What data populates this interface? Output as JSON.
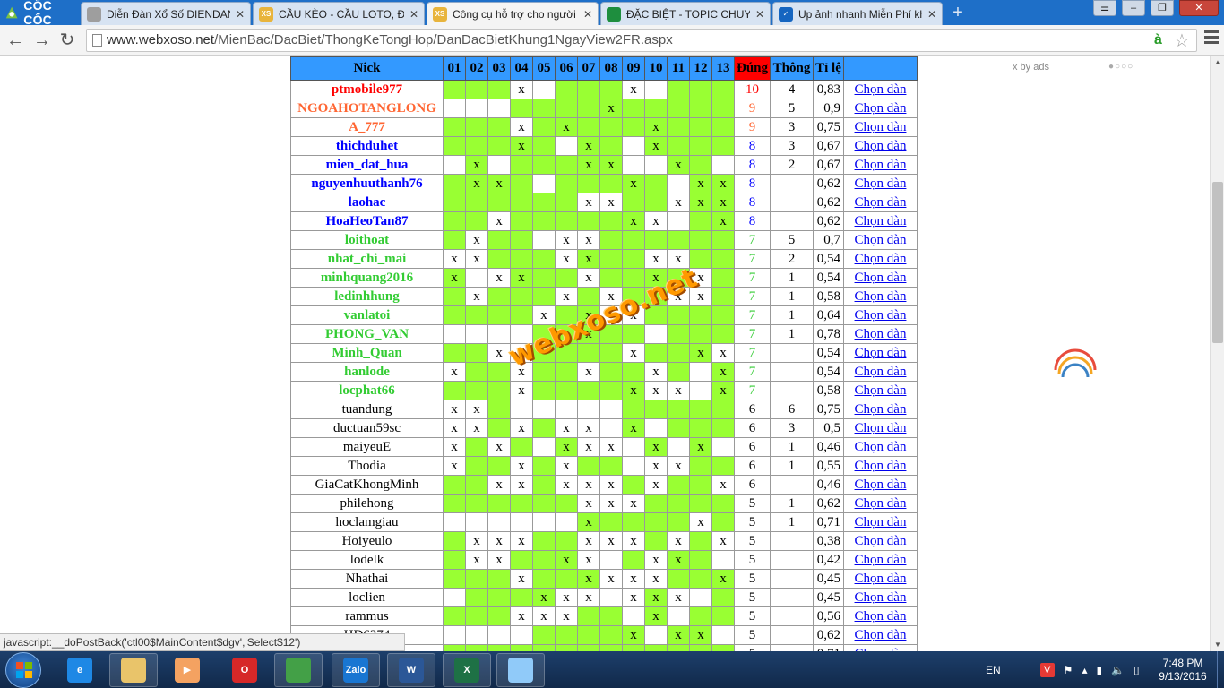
{
  "browser": {
    "brand": "CỐC CỐC",
    "tabs": [
      {
        "title": "Diễn Đàn Xổ Số DIENDAN",
        "icon": "page-icon",
        "active": false
      },
      {
        "title": "CẦU KÈO - CẦU LOTO, ĐÁ",
        "icon": "xs-icon",
        "active": false
      },
      {
        "title": "Công cụ hỗ trợ cho người",
        "icon": "xs-icon",
        "active": true
      },
      {
        "title": "ĐẶC BIỆT - TOPIC CHUYÊN",
        "icon": "sheet-icon",
        "active": false
      },
      {
        "title": "Up ảnh nhanh Miễn Phí kh",
        "icon": "check-icon",
        "active": false
      }
    ],
    "url_host": "www.webxoso.net",
    "url_path": "/MienBac/DacBiet/ThongKeTongHop/DanDacBietKhung1NgayView2FR.aspx",
    "status_text": "javascript:__doPostBack('ctl00$MainContent$dgv','Select$12')"
  },
  "table": {
    "headers": {
      "nick": "Nick",
      "cols": [
        "01",
        "02",
        "03",
        "04",
        "05",
        "06",
        "07",
        "08",
        "09",
        "10",
        "11",
        "12",
        "13"
      ],
      "dung": "Đúng",
      "thong": "Thông",
      "tile": "Tỉ lệ"
    },
    "link_label": "Chọn dàn",
    "rows": [
      {
        "nick": "ptmobile977",
        "color": "red",
        "cells": "ggg xggg xggg ",
        "x": "   x    x    ",
        "dung": "10",
        "thong": "4",
        "tile": "0,83"
      },
      {
        "nick": "NGOAHOTANGLONG",
        "color": "orange",
        "cells": "   ggggggggggg",
        "x": "       x     ",
        "dung": "9",
        "thong": "5",
        "tile": "0,9"
      },
      {
        "nick": "A_777",
        "color": "orange",
        "cells": "ggg gggggggggg",
        "x": "   x x   x   ",
        "dung": "9",
        "thong": "3",
        "tile": "0,75"
      },
      {
        "nick": "thichduhet",
        "color": "blue",
        "cells": "ggggg gg ggggg",
        "x": "   x  x  x   ",
        "dung": "8",
        "thong": "3",
        "tile": "0,67"
      },
      {
        "nick": "mien_dat_hua",
        "color": "blue",
        "cells": " g ggggg  gg gg",
        "x": " x    xx  x  ",
        "dung": "8",
        "thong": "2",
        "tile": "0,67"
      },
      {
        "nick": "nguyenhuuthanh76",
        "color": "blue",
        "cells": "gggg ggggg ggg",
        "x": " xx     x  xx",
        "dung": "8",
        "thong": "",
        "tile": "0,62"
      },
      {
        "nick": "laohac",
        "color": "blue",
        "cells": "gggggg  gg ggg",
        "x": "      xx  xxx",
        "dung": "8",
        "thong": "",
        "tile": "0,62"
      },
      {
        "nick": "HoaHeoTan87",
        "color": "blue",
        "cells": "gg gggggg  gg ",
        "x": "  x     xx  x",
        "dung": "8",
        "thong": "",
        "tile": "0,62"
      },
      {
        "nick": "loithoat",
        "color": "green",
        "cells": "g gg   ggggggg",
        "x": " x   xx      ",
        "dung": "7",
        "thong": "5",
        "tile": "0,7"
      },
      {
        "nick": "nhat_chi_mai",
        "color": "green",
        "cells": "  ggg ggg  gg",
        "x": "xx   xx  xx  ",
        "dung": "7",
        "thong": "2",
        "tile": "0,54"
      },
      {
        "nick": "minhquang2016",
        "color": "green",
        "cells": "g  ggg gggg gg",
        "x": "x xx  x  x x ",
        "dung": "7",
        "thong": "1",
        "tile": "0,54"
      },
      {
        "nick": "ledinhhung",
        "color": "green",
        "cells": "g ggg g gg  gg",
        "x": " x   x x  xx ",
        "dung": "7",
        "thong": "1",
        "tile": "0,58"
      },
      {
        "nick": "vanlatoi",
        "color": "green",
        "cells": "gggg gg  gggg",
        "x": "    x x x    ",
        "dung": "7",
        "thong": "1",
        "tile": "0,64"
      },
      {
        "nick": "PHONG_VAN",
        "color": "green",
        "cells": "    ggggg gggg",
        "x": "      x      ",
        "dung": "7",
        "thong": "1",
        "tile": "0,78"
      },
      {
        "nick": "Minh_Quan",
        "color": "green",
        "cells": "gg  gggg ggg  ",
        "x": "  xx    x  xx",
        "dung": "7",
        "thong": "",
        "tile": "0,54"
      },
      {
        "nick": "hanlode",
        "color": "green",
        "cells": " gg gg gg g g ",
        "x": "x  x  x  x  x",
        "dung": "7",
        "thong": "",
        "tile": "0,54"
      },
      {
        "nick": "locphat66",
        "color": "green",
        "cells": "ggg ggggg   g ",
        "x": "   x    xxx x",
        "dung": "7",
        "thong": "",
        "tile": "0,58"
      },
      {
        "nick": "tuandung",
        "color": "black",
        "cells": "  g     gggggg",
        "x": "xx           ",
        "dung": "6",
        "thong": "6",
        "tile": "0,75"
      },
      {
        "nick": "ductuan59sc",
        "color": "black",
        "cells": "  g g   g ggg",
        "x": "xx x xx x    ",
        "dung": "6",
        "thong": "3",
        "tile": "0,5"
      },
      {
        "nick": "maiyeuE",
        "color": "black",
        "cells": " g g g   g g ",
        "x": "x x  xxx x x ",
        "dung": "6",
        "thong": "1",
        "tile": "0,46"
      },
      {
        "nick": "Thodia",
        "color": "black",
        "cells": " gg g gg   ggg",
        "x": "x  x x   xx  ",
        "dung": "6",
        "thong": "1",
        "tile": "0,55"
      },
      {
        "nick": "GiaCatKhongMinh",
        "color": "black",
        "cells": "gg  g   g gg ",
        "x": "  xx xxx x  x",
        "dung": "6",
        "thong": "",
        "tile": "0,46"
      },
      {
        "nick": "philehong",
        "color": "black",
        "cells": "gggggg   gggg",
        "x": "      xxx    ",
        "dung": "5",
        "thong": "1",
        "tile": "0,62"
      },
      {
        "nick": "hoclamgiau",
        "color": "black",
        "cells": "      ggggg g ",
        "x": "      x    x ",
        "dung": "5",
        "thong": "1",
        "tile": "0,71"
      },
      {
        "nick": "Hoiyeulo",
        "color": "black",
        "cells": "g   gg   g g ",
        "x": " xxx  xxx x x",
        "dung": "5",
        "thong": "",
        "tile": "0,38"
      },
      {
        "nick": "lodelk",
        "color": "black",
        "cells": "g  ggg  g gg g",
        "x": " xx  xx  xx  ",
        "dung": "5",
        "thong": "",
        "tile": "0,42"
      },
      {
        "nick": "Nhathai",
        "color": "black",
        "cells": "ggg ggg   ggg ",
        "x": "   x  xxxx  x",
        "dung": "5",
        "thong": "",
        "tile": "0,45"
      },
      {
        "nick": "loclien",
        "color": "black",
        "cells": " gggg    g  g ",
        "x": "    xxx xxx  ",
        "dung": "5",
        "thong": "",
        "tile": "0,45"
      },
      {
        "nick": "rammus",
        "color": "black",
        "cells": "ggg   gg g ggg",
        "x": "   xxx   x   ",
        "dung": "5",
        "thong": "",
        "tile": "0,56"
      },
      {
        "nick": "HD6374",
        "color": "black",
        "cells": "    ggggg gg g",
        "x": "        x xx ",
        "dung": "5",
        "thong": "",
        "tile": "0,62"
      },
      {
        "nick": "",
        "color": "black",
        "cells": "gggggggggggggg",
        "x": "             ",
        "dung": "5",
        "thong": "",
        "tile": "0,71"
      }
    ]
  },
  "overlay": {
    "watermark": "webxoso.net",
    "ads_label": "x by ads",
    "ads_dots": "●○○○"
  },
  "taskbar": {
    "apps": [
      {
        "name": "internet-explorer-icon",
        "label": "e",
        "color": "#1e88e5"
      },
      {
        "name": "file-explorer-icon",
        "label": "",
        "color": "#e9c46a"
      },
      {
        "name": "media-player-icon",
        "label": "▶",
        "color": "#f4a261"
      },
      {
        "name": "opera-icon",
        "label": "O",
        "color": "#d62828"
      },
      {
        "name": "coccoc-icon",
        "label": "",
        "color": "#43a047"
      },
      {
        "name": "zalo-icon",
        "label": "Zalo",
        "color": "#1976d2"
      },
      {
        "name": "word-icon",
        "label": "W",
        "color": "#2b5797"
      },
      {
        "name": "excel-icon",
        "label": "X",
        "color": "#1e7145"
      },
      {
        "name": "paint-icon",
        "label": "",
        "color": "#90caf9"
      }
    ],
    "lang": "EN",
    "time": "7:48 PM",
    "date": "9/13/2016"
  }
}
